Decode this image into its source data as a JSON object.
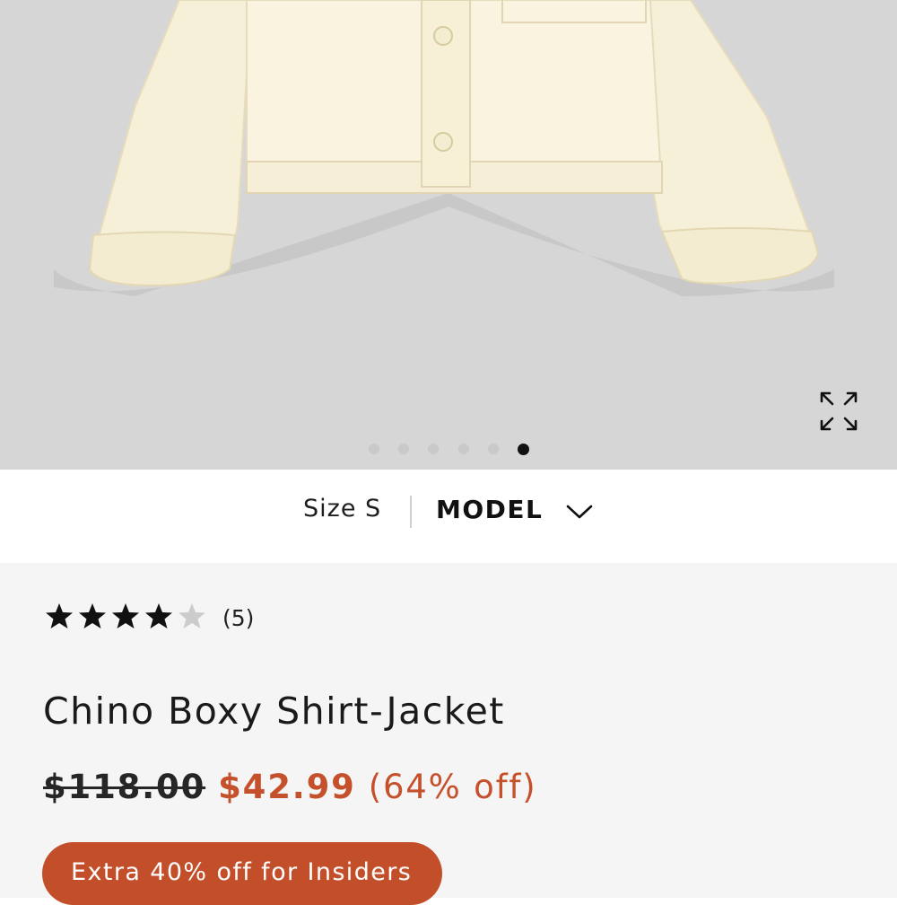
{
  "gallery": {
    "image_alt": "Chino Boxy Shirt-Jacket product photo",
    "active_index": 6,
    "dot_count": 6,
    "expand_icon": "expand-arrows-icon"
  },
  "size_selector": {
    "size_label": "Size S",
    "model_label": "MODEL",
    "chevron_icon": "chevron-down-icon"
  },
  "product": {
    "rating": 4,
    "rating_max": 5,
    "review_count": "(5)",
    "title": "Chino Boxy Shirt-Jacket",
    "price_original": "$118.00",
    "price_sale": "$42.99",
    "discount": "(64% off)",
    "promo_label": "Extra 40% off for Insiders"
  },
  "colors": {
    "sale": "#c5502c",
    "promo_bg": "#c34e2a",
    "image_bg": "#d6d6d6",
    "panel_bg": "#f5f5f5",
    "star_filled": "#111111",
    "star_empty": "#cccccc"
  }
}
